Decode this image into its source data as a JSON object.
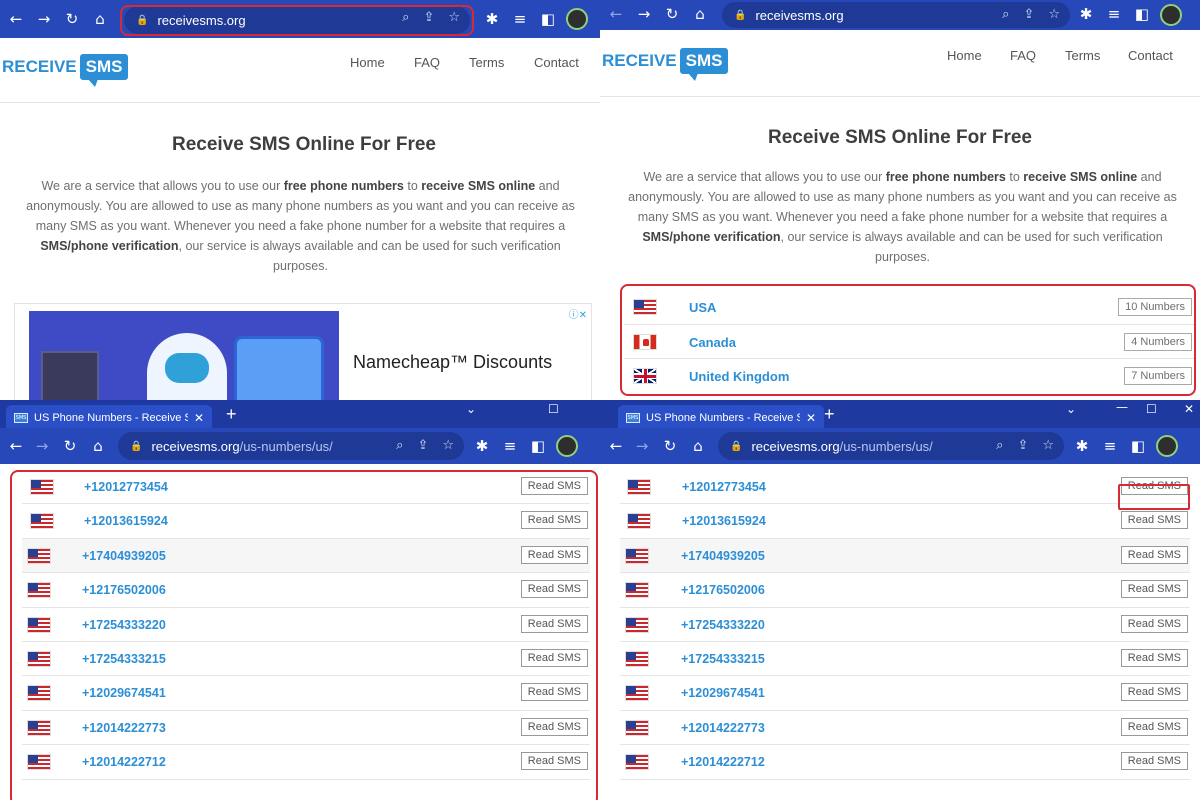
{
  "panel1": {
    "url": "receivesms.org",
    "logo": {
      "word1": "RECEIVE",
      "word2": "SMS"
    },
    "nav": [
      "Home",
      "FAQ",
      "Terms",
      "Contact"
    ],
    "title": "Receive SMS Online For Free",
    "description": {
      "t1": "We are a service that allows you to use our ",
      "b1": "free phone numbers",
      "t2": " to ",
      "b2": "receive SMS online",
      "t3": " and anonymously. You are allowed to use as many phone numbers as you want and you can receive as many SMS as you want. Whenever you need a fake phone number for a website that requires a ",
      "b3": "SMS/phone verification",
      "t4": ", our service is always available and can be used for such verification purposes."
    },
    "ad": {
      "text": "Namecheap™ Discounts",
      "info_icon": "info-icon"
    }
  },
  "panel2": {
    "url": "receivesms.org",
    "logo": {
      "word1": "RECEIVE",
      "word2": "SMS"
    },
    "nav": [
      "Home",
      "FAQ",
      "Terms",
      "Contact"
    ],
    "title": "Receive SMS Online For Free",
    "countries": [
      {
        "name": "USA",
        "count": "10 Numbers",
        "flag": "us"
      },
      {
        "name": "Canada",
        "count": "4 Numbers",
        "flag": "ca"
      },
      {
        "name": "United Kingdom",
        "count": "7 Numbers",
        "flag": "uk"
      }
    ]
  },
  "panel3": {
    "tab_title": "US Phone Numbers - Receive SM",
    "url_host": "receivesms.org",
    "url_path": "/us-numbers/us/",
    "read_label": "Read SMS",
    "numbers": [
      "+12012773454",
      "+12013615924",
      "+17404939205",
      "+12176502006",
      "+17254333220",
      "+17254333215",
      "+12029674541",
      "+12014222773",
      "+12014222712"
    ]
  },
  "panel4": {
    "tab_title": "US Phone Numbers - Receive SM",
    "url_host": "receivesms.org",
    "url_path": "/us-numbers/us/",
    "read_label": "Read SMS",
    "numbers": [
      "+12012773454",
      "+12013615924",
      "+17404939205",
      "+12176502006",
      "+17254333220",
      "+17254333215",
      "+12029674541",
      "+12014222773",
      "+12014222712"
    ]
  },
  "colors": {
    "chrome": "#2748b8",
    "tabbar": "#1e3aa0",
    "link": "#2c8fd6",
    "highlight": "#d62a36"
  }
}
